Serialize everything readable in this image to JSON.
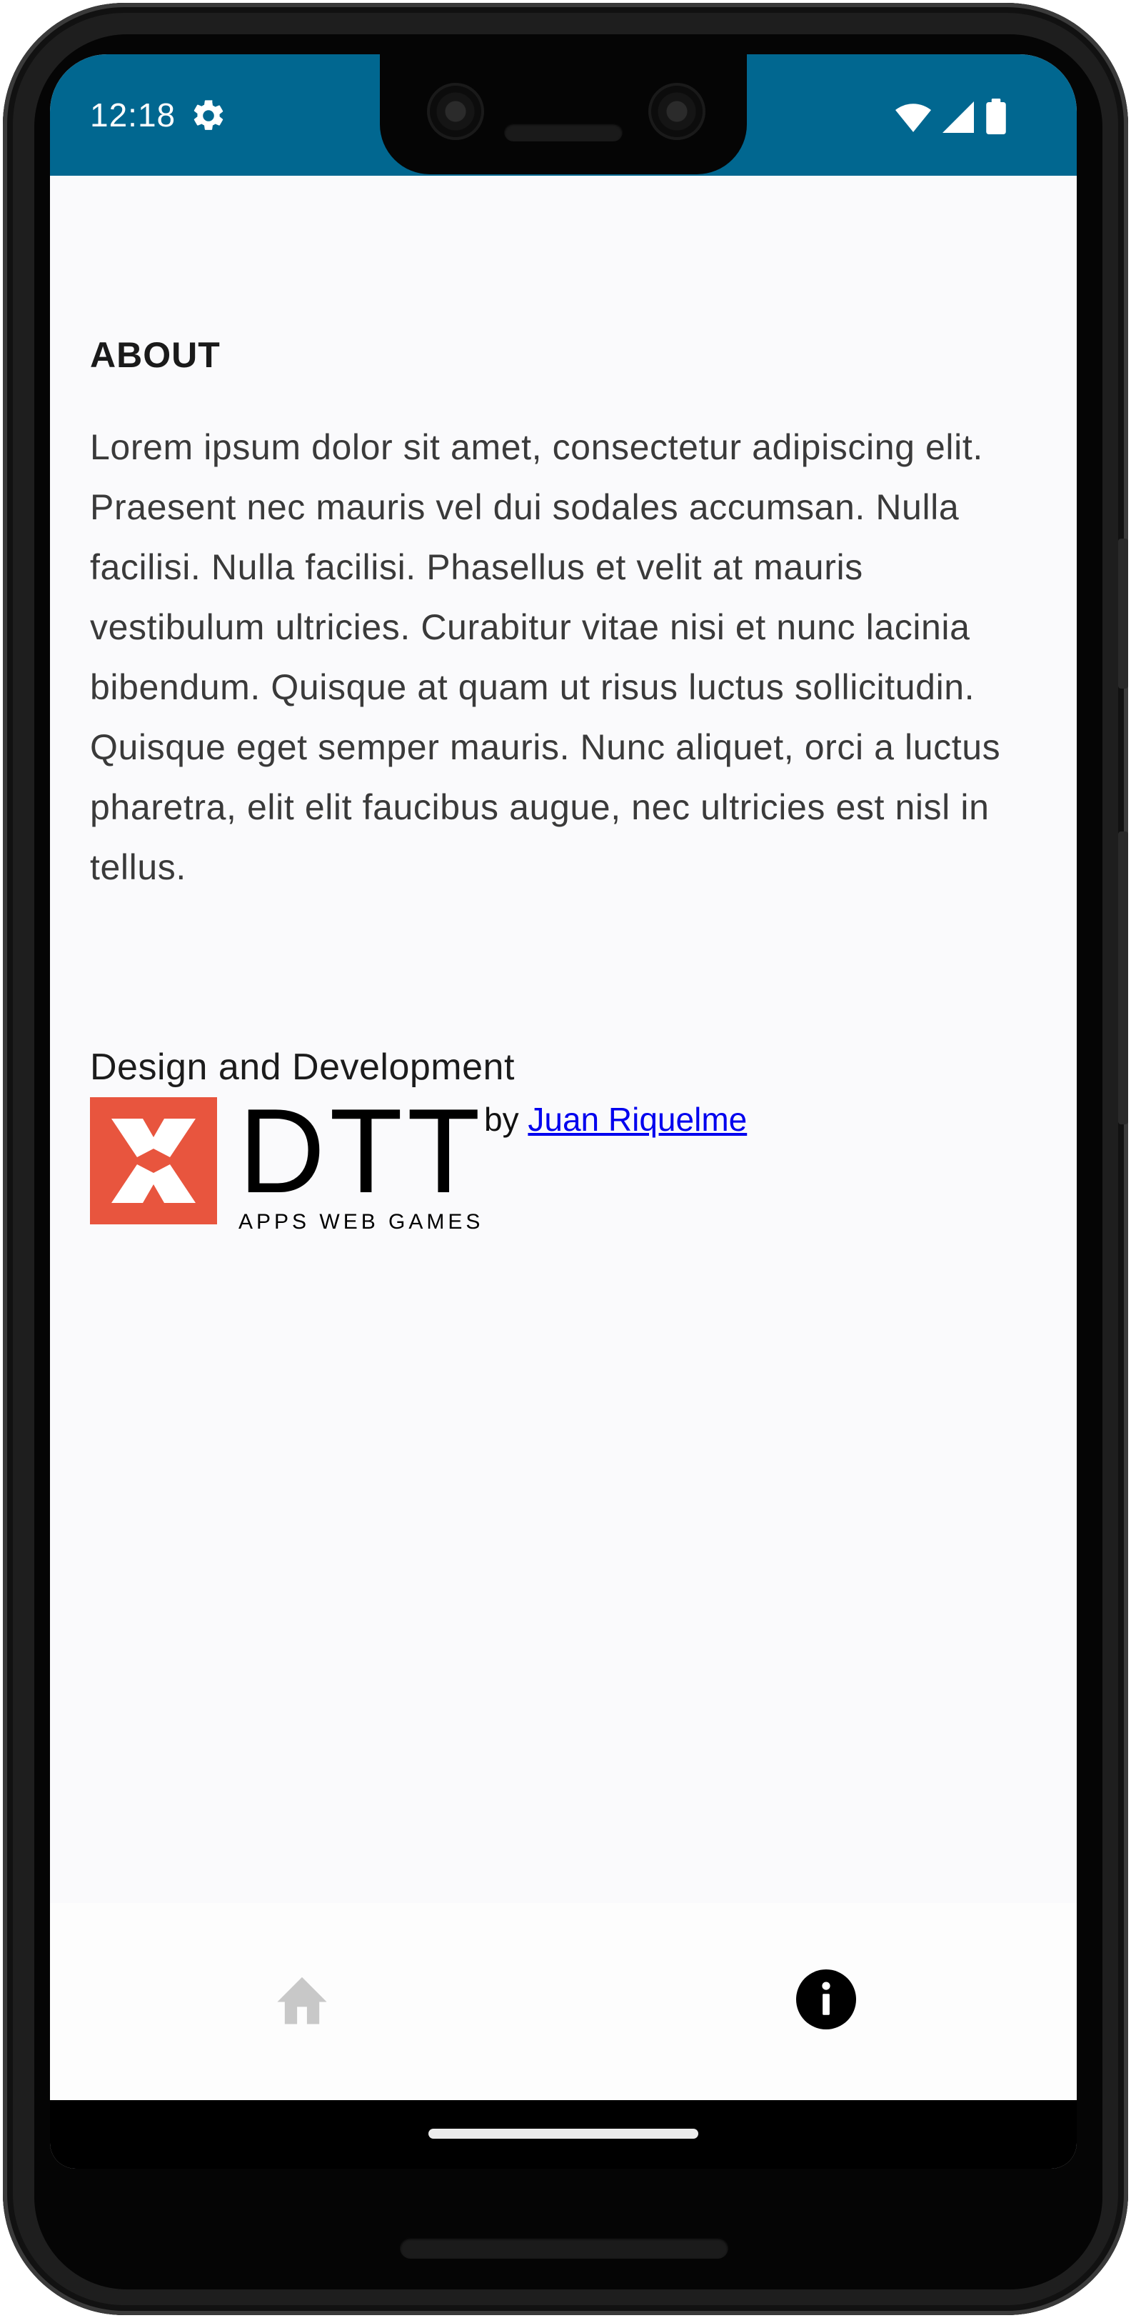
{
  "status_bar": {
    "time": "12:18",
    "background_color": "#016790",
    "icons": [
      "gear-icon",
      "wifi-icon",
      "signal-icon",
      "battery-icon"
    ]
  },
  "about": {
    "title": "ABOUT",
    "body": "Lorem ipsum dolor sit amet, consectetur adipiscing elit. Praesent nec mauris vel dui sodales accumsan. Nulla facilisi. Nulla facilisi. Phasellus et velit at mauris vestibulum ultricies. Curabitur vitae nisi et nunc lacinia bibendum. Quisque at quam ut risus luctus sollicitudin. Quisque eget semper mauris. Nunc aliquet, orci a luctus pharetra, elit elit faucibus augue, nec ultricies est nisl in tellus."
  },
  "credits": {
    "title": "Design and Development",
    "logo": {
      "wordmark": "DTT",
      "tagline": "APPS WEB GAMES",
      "brand_color": "#e8553e"
    },
    "by_prefix": "by",
    "author_link": "Juan Riquelme"
  },
  "bottom_nav": {
    "items": [
      {
        "name": "home",
        "icon": "home-icon",
        "active": false,
        "color": "#c8c8c8"
      },
      {
        "name": "info",
        "icon": "info-icon",
        "active": true,
        "color": "#000000"
      }
    ]
  }
}
